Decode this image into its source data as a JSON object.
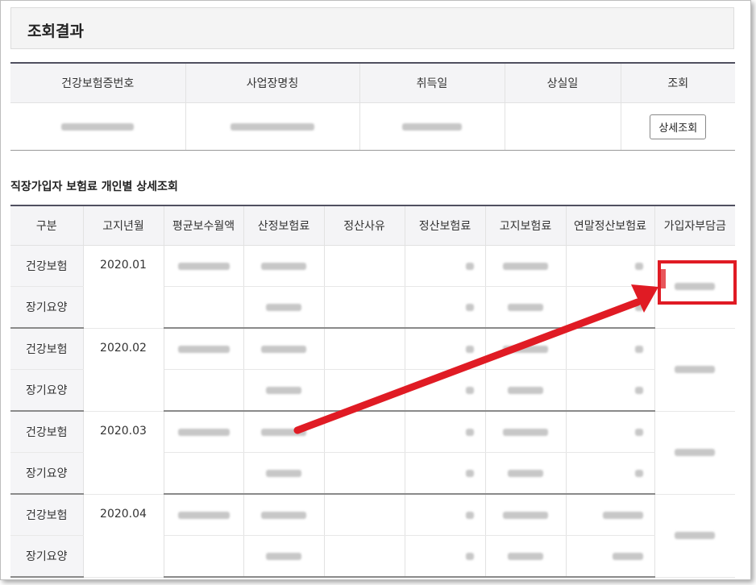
{
  "result": {
    "title": "조회결과",
    "headers": [
      "건강보험증번호",
      "사업장명칭",
      "취득일",
      "상실일",
      "조회"
    ],
    "detail_button": "상세조회"
  },
  "detail": {
    "title": "직장가입자 보험료 개인별 상세조회",
    "headers": [
      "구분",
      "고지년월",
      "평균보수월액",
      "산정보험료",
      "정산사유",
      "정산보험료",
      "고지보험료",
      "연말정산보험료",
      "가입자부담금"
    ],
    "rows": [
      {
        "type": "건강보험",
        "month": "2020.01"
      },
      {
        "type": "장기요양",
        "month": ""
      },
      {
        "type": "건강보험",
        "month": "2020.02"
      },
      {
        "type": "장기요양",
        "month": ""
      },
      {
        "type": "건강보험",
        "month": "2020.03"
      },
      {
        "type": "장기요양",
        "month": ""
      },
      {
        "type": "건강보험",
        "month": "2020.04"
      },
      {
        "type": "장기요양",
        "month": ""
      }
    ]
  },
  "colors": {
    "highlight": "#e01b24",
    "header_border": "#505060"
  }
}
